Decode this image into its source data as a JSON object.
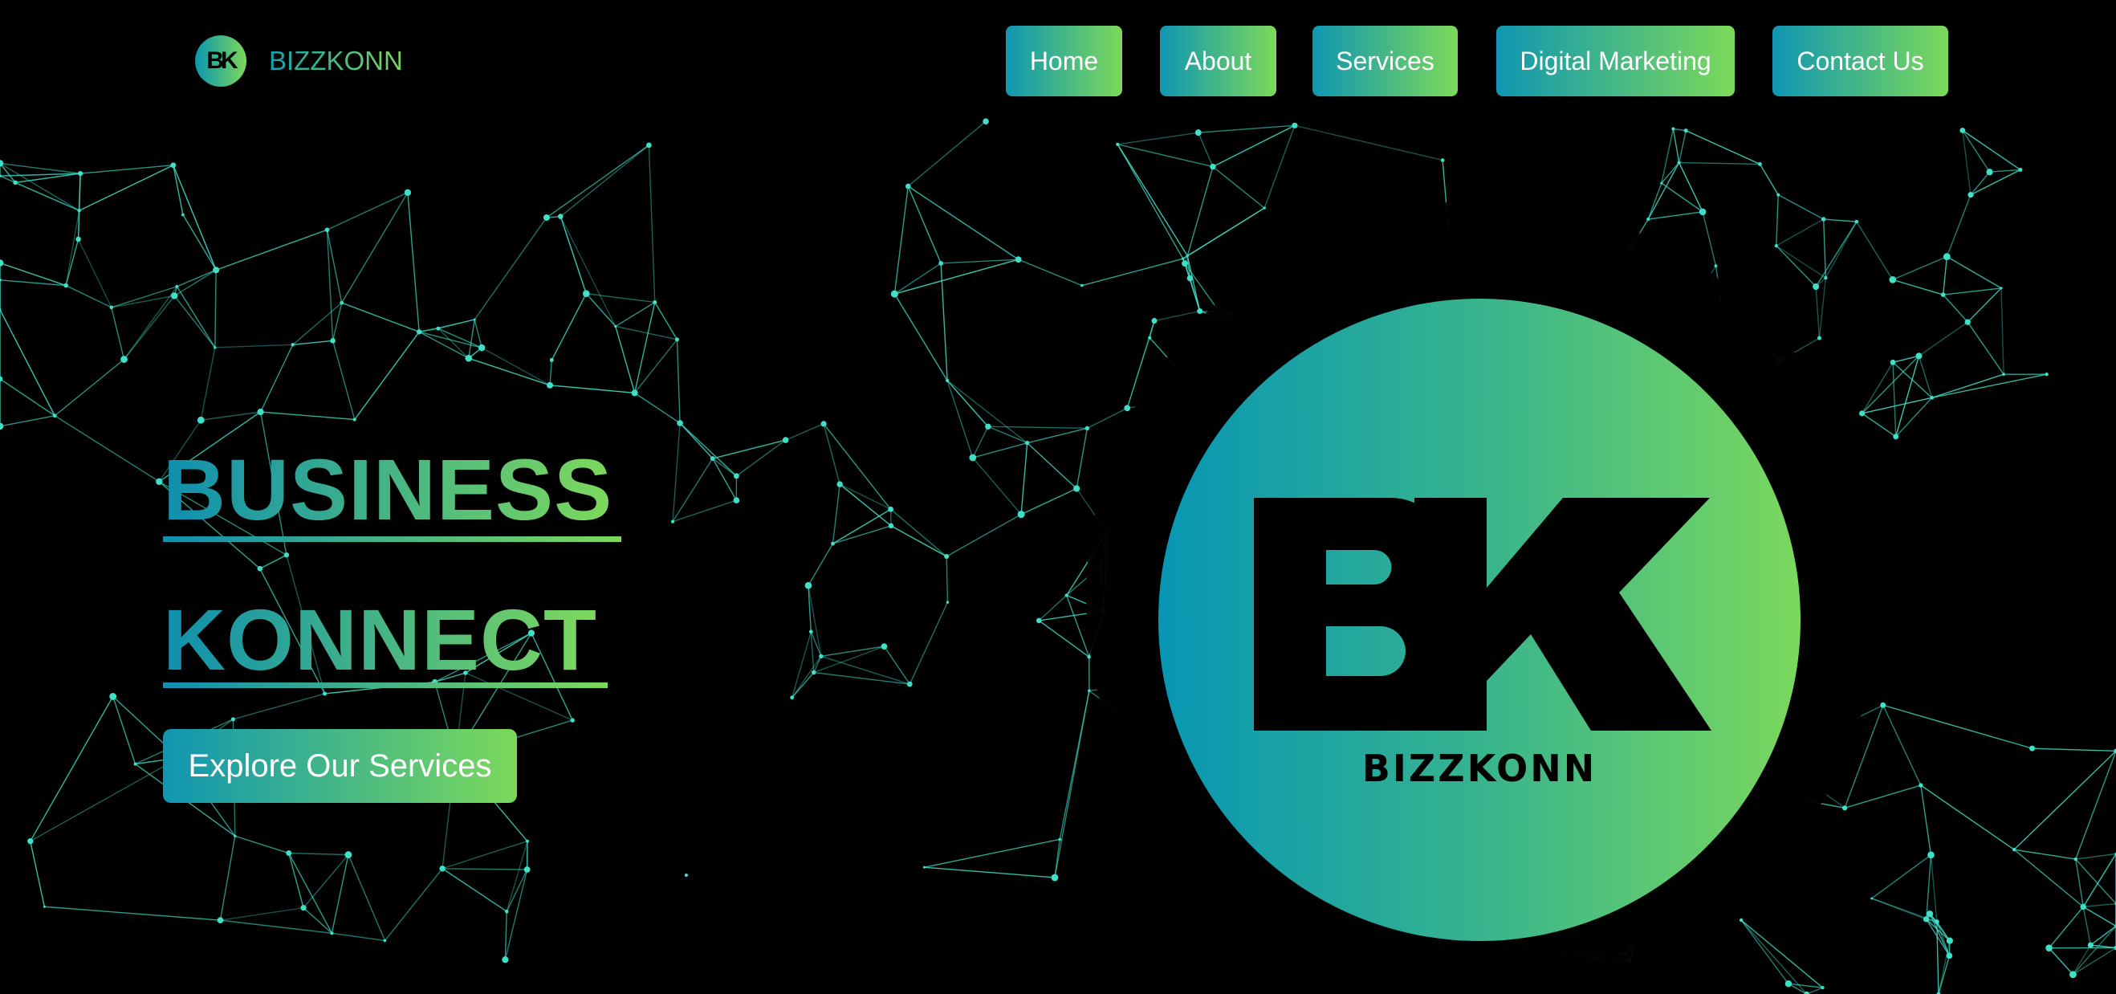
{
  "brand": {
    "logo_text": "BK",
    "name": "BIZZKONN"
  },
  "nav": {
    "items": [
      {
        "label": "Home"
      },
      {
        "label": "About"
      },
      {
        "label": "Services"
      },
      {
        "label": "Digital Marketing"
      },
      {
        "label": "Contact Us"
      }
    ]
  },
  "hero": {
    "line1": "BUSINESS",
    "line2": "KONNECT",
    "cta_label": "Explore Our Services"
  },
  "logo": {
    "monogram": "BK",
    "wordmark": "BIZZKONN"
  },
  "colors": {
    "gradient_start": "#0f96b2",
    "gradient_end": "#7cd95a",
    "network": "#3fe0c8",
    "background": "#000000"
  },
  "icons": {
    "background": "network-mesh-icon",
    "brand": "bk-logo-icon"
  }
}
